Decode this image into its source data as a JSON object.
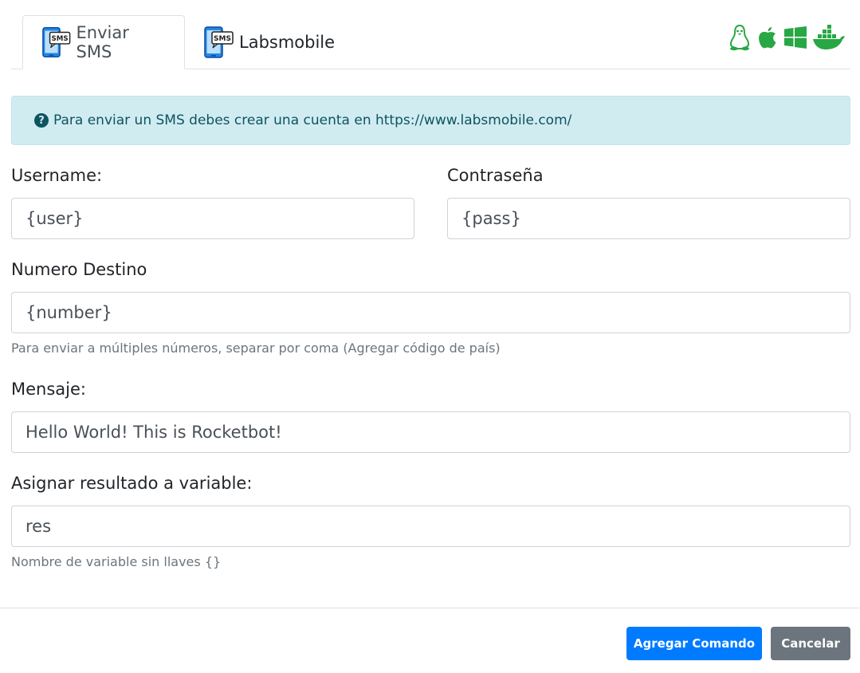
{
  "tabs": [
    {
      "label": "Enviar SMS",
      "icon": "sms-phone-icon",
      "active": true
    },
    {
      "label": "Labsmobile",
      "icon": "sms-phone-icon",
      "active": false
    }
  ],
  "sms_icon_text": "SMS",
  "os_icons": [
    "linux-icon",
    "apple-icon",
    "windows-icon",
    "docker-icon"
  ],
  "colors": {
    "os_green": "#28a745",
    "primary": "#007bff",
    "secondary": "#6c757d",
    "alert_bg": "#d1ecf1",
    "alert_text": "#0c5460"
  },
  "alert": {
    "icon": "question-circle-icon",
    "text": "Para enviar un SMS debes crear una cuenta en https://www.labsmobile.com/"
  },
  "form": {
    "username": {
      "label": "Username:",
      "value": "{user}"
    },
    "password": {
      "label": "Contraseña",
      "value": "{pass}"
    },
    "number": {
      "label": "Numero Destino",
      "value": "{number}",
      "help": "Para enviar a múltiples números, separar por coma (Agregar código de país)"
    },
    "message": {
      "label": "Mensaje:",
      "value": "Hello World! This is Rocketbot!"
    },
    "result_var": {
      "label": "Asignar resultado a variable:",
      "value": "res",
      "help": "Nombre de variable sin llaves {}"
    }
  },
  "buttons": {
    "add": "Agregar Comando",
    "cancel": "Cancelar"
  }
}
